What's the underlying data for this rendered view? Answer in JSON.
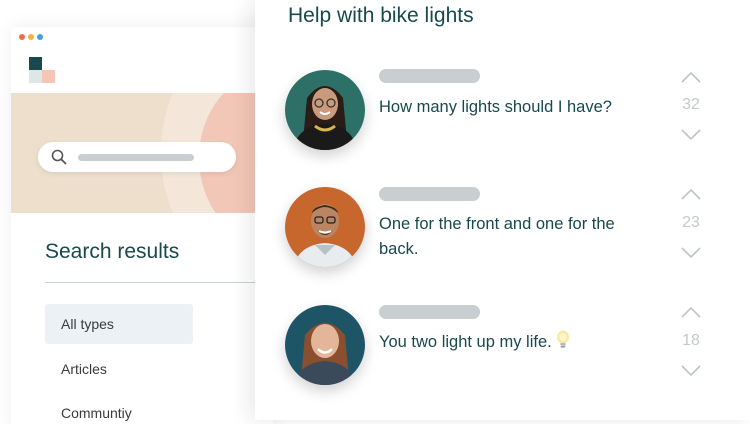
{
  "window": {
    "dots": [
      "#ee6b50",
      "#f4b43b",
      "#43a1d8"
    ]
  },
  "search_page": {
    "title": "Search results",
    "filters": [
      {
        "label": "All types",
        "active": true
      },
      {
        "label": "Articles",
        "active": false
      },
      {
        "label": "Communtiy",
        "active": false
      }
    ]
  },
  "thread": {
    "title": "Help with bike lights",
    "posts": [
      {
        "message": "How many lights should I have?",
        "votes": "32",
        "avatar": "woman-glasses-avatar"
      },
      {
        "message": "One for the front and one for the back.",
        "votes": "23",
        "avatar": "man-glasses-avatar"
      },
      {
        "message": "You two light up my life.",
        "votes": "18",
        "avatar": "woman-smiling-avatar",
        "emoji": "light-bulb-icon"
      }
    ]
  },
  "colors": {
    "accent": "#17494d",
    "placeholder_bar": "#c9ced0",
    "hero_beige": "#eedfcd",
    "hero_pink": "#f3c7b8",
    "active_filter_bg": "#ecf1f6"
  }
}
